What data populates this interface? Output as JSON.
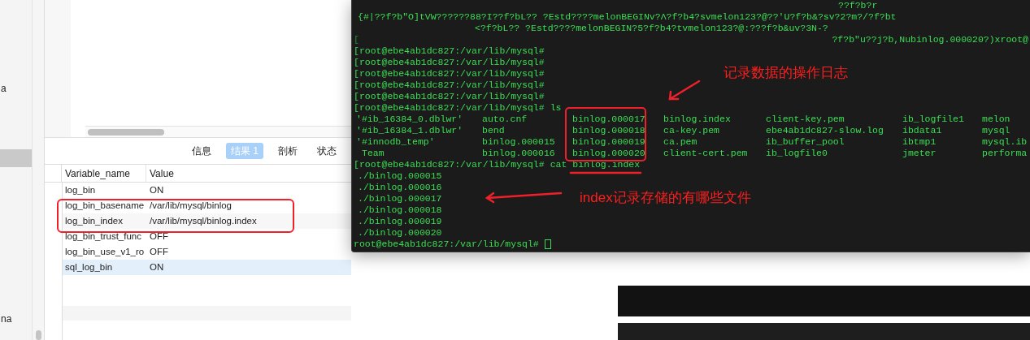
{
  "sidebar": {
    "items": [
      {
        "text": "a",
        "selected": false
      },
      {
        "selected": true
      },
      {
        "text": "na",
        "selected": false
      }
    ]
  },
  "result_tabs": [
    {
      "label": "信息",
      "selected": false
    },
    {
      "label": "结果 1",
      "selected": true
    },
    {
      "label": "剖析",
      "selected": false
    },
    {
      "label": "状态",
      "selected": false
    }
  ],
  "table": {
    "columns": [
      "Variable_name",
      "Value"
    ],
    "rows": [
      {
        "cells": [
          "log_bin",
          "ON"
        ],
        "selected": false
      },
      {
        "cells": [
          "log_bin_basename",
          "/var/lib/mysql/binlog"
        ],
        "selected": false
      },
      {
        "cells": [
          "log_bin_index",
          "/var/lib/mysql/binlog.index"
        ],
        "selected": false
      },
      {
        "cells": [
          "log_bin_trust_func",
          "OFF"
        ],
        "selected": false
      },
      {
        "cells": [
          "log_bin_use_v1_ro",
          "OFF"
        ],
        "selected": false
      },
      {
        "cells": [
          "sql_log_bin",
          "ON"
        ],
        "selected": true
      }
    ]
  },
  "terminal": {
    "lines": [
      {
        "kind": "binary",
        "segments": [
          "??f?b?r"
        ]
      },
      {
        "kind": "binary",
        "segments": [
          "{#|??f?b\"O]tVW??????88?I??f?bL?? ?Estd????melonBEGINv?Λ?f?b4?svmelon123?@??'U?f?b&?sv?2?m?/?f?bt"
        ]
      },
      {
        "kind": "binary",
        "segments": [
          "<?f?bL?? ?Estd????melonBEGIN?5?f?b4?tvmelon123?@:???f?b&uv?3N-?"
        ]
      },
      {
        "kind": "binary",
        "segments": [
          "[",
          "?f?b\"u??j?b,Nubinlog.000020?)xroot@"
        ]
      },
      {
        "kind": "prompt",
        "prompt": "[root@ebe4ab1dc827:/var/lib/mysql#"
      },
      {
        "kind": "prompt",
        "prompt": "[root@ebe4ab1dc827:/var/lib/mysql#"
      },
      {
        "kind": "prompt",
        "prompt": "[root@ebe4ab1dc827:/var/lib/mysql#"
      },
      {
        "kind": "prompt",
        "prompt": "[root@ebe4ab1dc827:/var/lib/mysql#"
      },
      {
        "kind": "prompt",
        "prompt": "[root@ebe4ab1dc827:/var/lib/mysql#"
      },
      {
        "kind": "prompt",
        "prompt": "[root@ebe4ab1dc827:/var/lib/mysql#",
        "command": "ls"
      },
      {
        "kind": "columns",
        "cells": [
          "'#ib_16384_0.dblwr'",
          "auto.cnf",
          "binlog.000017",
          "binlog.index",
          "client-key.pem",
          "ib_logfile1",
          "melon"
        ]
      },
      {
        "kind": "columns",
        "cells": [
          "'#ib_16384_1.dblwr'",
          "bend",
          "binlog.000018",
          "ca-key.pem",
          "ebe4ab1dc827-slow.log",
          "ibdata1",
          "mysql"
        ]
      },
      {
        "kind": "columns",
        "cells": [
          "'#innodb_temp'",
          "binlog.000015",
          "binlog.000019",
          "ca.pem",
          "ib_buffer_pool",
          "ibtmp1",
          "mysql.ib"
        ]
      },
      {
        "kind": "columns",
        "cells": [
          "Team",
          "binlog.000016",
          "binlog.000020",
          "client-cert.pem",
          "ib_logfile0",
          "jmeter",
          "performa"
        ]
      },
      {
        "kind": "prompt",
        "prompt": "[root@ebe4ab1dc827:/var/lib/mysql#",
        "command": "cat",
        "argument": "binlog.index"
      },
      {
        "kind": "output",
        "text": "./binlog.000015"
      },
      {
        "kind": "output",
        "text": "./binlog.000016"
      },
      {
        "kind": "output",
        "text": "./binlog.000017"
      },
      {
        "kind": "output",
        "text": "./binlog.000018"
      },
      {
        "kind": "output",
        "text": "./binlog.000019"
      },
      {
        "kind": "output",
        "text": "./binlog.000020"
      },
      {
        "kind": "prompt",
        "prompt": "root@ebe4ab1dc827:/var/lib/mysql#",
        "cursor": true
      }
    ]
  },
  "annotations": [
    {
      "text": "记录数据的操作日志"
    },
    {
      "text": "index记录存储的有哪些文件"
    }
  ]
}
